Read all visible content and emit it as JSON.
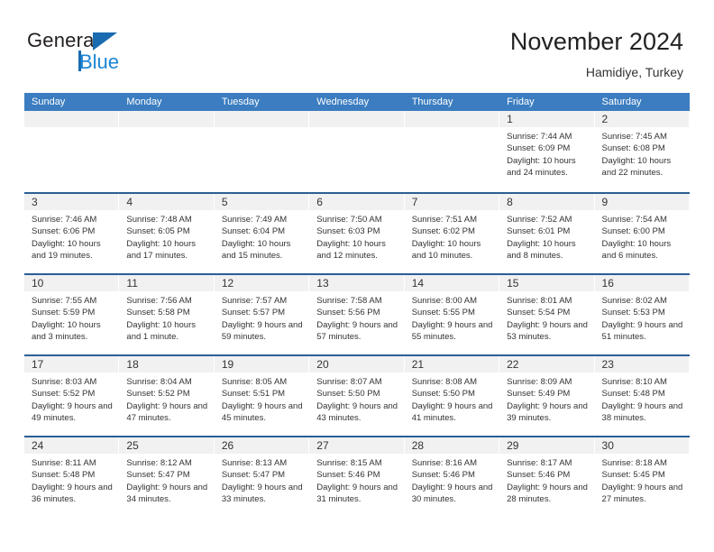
{
  "brand": {
    "name_part1": "General",
    "name_part2": "Blue",
    "triangle_icon": "blue-triangle-icon",
    "accent_color": "#1b85d6"
  },
  "header": {
    "title": "November 2024",
    "subtitle": "Hamidiye, Turkey"
  },
  "theme": {
    "header_bg": "#3b7dc0",
    "row_divider": "#2b5f96",
    "daynum_bg": "#f1f1f1",
    "text": "#333333"
  },
  "weekdays": [
    "Sunday",
    "Monday",
    "Tuesday",
    "Wednesday",
    "Thursday",
    "Friday",
    "Saturday"
  ],
  "weeks": [
    [
      {
        "day": "",
        "sunrise": "",
        "sunset": "",
        "daylight": ""
      },
      {
        "day": "",
        "sunrise": "",
        "sunset": "",
        "daylight": ""
      },
      {
        "day": "",
        "sunrise": "",
        "sunset": "",
        "daylight": ""
      },
      {
        "day": "",
        "sunrise": "",
        "sunset": "",
        "daylight": ""
      },
      {
        "day": "",
        "sunrise": "",
        "sunset": "",
        "daylight": ""
      },
      {
        "day": "1",
        "sunrise": "Sunrise: 7:44 AM",
        "sunset": "Sunset: 6:09 PM",
        "daylight": "Daylight: 10 hours and 24 minutes."
      },
      {
        "day": "2",
        "sunrise": "Sunrise: 7:45 AM",
        "sunset": "Sunset: 6:08 PM",
        "daylight": "Daylight: 10 hours and 22 minutes."
      }
    ],
    [
      {
        "day": "3",
        "sunrise": "Sunrise: 7:46 AM",
        "sunset": "Sunset: 6:06 PM",
        "daylight": "Daylight: 10 hours and 19 minutes."
      },
      {
        "day": "4",
        "sunrise": "Sunrise: 7:48 AM",
        "sunset": "Sunset: 6:05 PM",
        "daylight": "Daylight: 10 hours and 17 minutes."
      },
      {
        "day": "5",
        "sunrise": "Sunrise: 7:49 AM",
        "sunset": "Sunset: 6:04 PM",
        "daylight": "Daylight: 10 hours and 15 minutes."
      },
      {
        "day": "6",
        "sunrise": "Sunrise: 7:50 AM",
        "sunset": "Sunset: 6:03 PM",
        "daylight": "Daylight: 10 hours and 12 minutes."
      },
      {
        "day": "7",
        "sunrise": "Sunrise: 7:51 AM",
        "sunset": "Sunset: 6:02 PM",
        "daylight": "Daylight: 10 hours and 10 minutes."
      },
      {
        "day": "8",
        "sunrise": "Sunrise: 7:52 AM",
        "sunset": "Sunset: 6:01 PM",
        "daylight": "Daylight: 10 hours and 8 minutes."
      },
      {
        "day": "9",
        "sunrise": "Sunrise: 7:54 AM",
        "sunset": "Sunset: 6:00 PM",
        "daylight": "Daylight: 10 hours and 6 minutes."
      }
    ],
    [
      {
        "day": "10",
        "sunrise": "Sunrise: 7:55 AM",
        "sunset": "Sunset: 5:59 PM",
        "daylight": "Daylight: 10 hours and 3 minutes."
      },
      {
        "day": "11",
        "sunrise": "Sunrise: 7:56 AM",
        "sunset": "Sunset: 5:58 PM",
        "daylight": "Daylight: 10 hours and 1 minute."
      },
      {
        "day": "12",
        "sunrise": "Sunrise: 7:57 AM",
        "sunset": "Sunset: 5:57 PM",
        "daylight": "Daylight: 9 hours and 59 minutes."
      },
      {
        "day": "13",
        "sunrise": "Sunrise: 7:58 AM",
        "sunset": "Sunset: 5:56 PM",
        "daylight": "Daylight: 9 hours and 57 minutes."
      },
      {
        "day": "14",
        "sunrise": "Sunrise: 8:00 AM",
        "sunset": "Sunset: 5:55 PM",
        "daylight": "Daylight: 9 hours and 55 minutes."
      },
      {
        "day": "15",
        "sunrise": "Sunrise: 8:01 AM",
        "sunset": "Sunset: 5:54 PM",
        "daylight": "Daylight: 9 hours and 53 minutes."
      },
      {
        "day": "16",
        "sunrise": "Sunrise: 8:02 AM",
        "sunset": "Sunset: 5:53 PM",
        "daylight": "Daylight: 9 hours and 51 minutes."
      }
    ],
    [
      {
        "day": "17",
        "sunrise": "Sunrise: 8:03 AM",
        "sunset": "Sunset: 5:52 PM",
        "daylight": "Daylight: 9 hours and 49 minutes."
      },
      {
        "day": "18",
        "sunrise": "Sunrise: 8:04 AM",
        "sunset": "Sunset: 5:52 PM",
        "daylight": "Daylight: 9 hours and 47 minutes."
      },
      {
        "day": "19",
        "sunrise": "Sunrise: 8:05 AM",
        "sunset": "Sunset: 5:51 PM",
        "daylight": "Daylight: 9 hours and 45 minutes."
      },
      {
        "day": "20",
        "sunrise": "Sunrise: 8:07 AM",
        "sunset": "Sunset: 5:50 PM",
        "daylight": "Daylight: 9 hours and 43 minutes."
      },
      {
        "day": "21",
        "sunrise": "Sunrise: 8:08 AM",
        "sunset": "Sunset: 5:50 PM",
        "daylight": "Daylight: 9 hours and 41 minutes."
      },
      {
        "day": "22",
        "sunrise": "Sunrise: 8:09 AM",
        "sunset": "Sunset: 5:49 PM",
        "daylight": "Daylight: 9 hours and 39 minutes."
      },
      {
        "day": "23",
        "sunrise": "Sunrise: 8:10 AM",
        "sunset": "Sunset: 5:48 PM",
        "daylight": "Daylight: 9 hours and 38 minutes."
      }
    ],
    [
      {
        "day": "24",
        "sunrise": "Sunrise: 8:11 AM",
        "sunset": "Sunset: 5:48 PM",
        "daylight": "Daylight: 9 hours and 36 minutes."
      },
      {
        "day": "25",
        "sunrise": "Sunrise: 8:12 AM",
        "sunset": "Sunset: 5:47 PM",
        "daylight": "Daylight: 9 hours and 34 minutes."
      },
      {
        "day": "26",
        "sunrise": "Sunrise: 8:13 AM",
        "sunset": "Sunset: 5:47 PM",
        "daylight": "Daylight: 9 hours and 33 minutes."
      },
      {
        "day": "27",
        "sunrise": "Sunrise: 8:15 AM",
        "sunset": "Sunset: 5:46 PM",
        "daylight": "Daylight: 9 hours and 31 minutes."
      },
      {
        "day": "28",
        "sunrise": "Sunrise: 8:16 AM",
        "sunset": "Sunset: 5:46 PM",
        "daylight": "Daylight: 9 hours and 30 minutes."
      },
      {
        "day": "29",
        "sunrise": "Sunrise: 8:17 AM",
        "sunset": "Sunset: 5:46 PM",
        "daylight": "Daylight: 9 hours and 28 minutes."
      },
      {
        "day": "30",
        "sunrise": "Sunrise: 8:18 AM",
        "sunset": "Sunset: 5:45 PM",
        "daylight": "Daylight: 9 hours and 27 minutes."
      }
    ]
  ]
}
